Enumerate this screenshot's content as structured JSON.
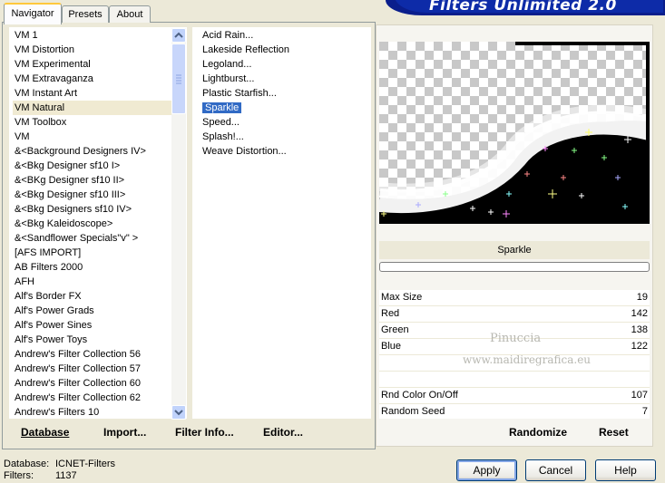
{
  "banner": {
    "title": "Filters Unlimited 2.0"
  },
  "tabs": [
    {
      "label": "Navigator"
    },
    {
      "label": "Presets"
    },
    {
      "label": "About"
    }
  ],
  "categories": [
    "VM 1",
    "VM Distortion",
    "VM Experimental",
    "VM Extravaganza",
    "VM Instant Art",
    "VM Natural",
    "VM Toolbox",
    "VM",
    "&<Background Designers IV>",
    "&<Bkg Designer sf10 I>",
    "&<BKg Designer sf10 II>",
    "&<Bkg Designer sf10 III>",
    "&<Bkg Designers sf10 IV>",
    "&<Bkg Kaleidoscope>",
    "&<Sandflower Specials\"v\" >",
    "[AFS IMPORT]",
    "AB Filters 2000",
    "AFH",
    "Alf's Border FX",
    "Alf's Power Grads",
    "Alf's Power Sines",
    "Alf's Power Toys",
    "Andrew's Filter Collection 56",
    "Andrew's Filter Collection 57",
    "Andrew's Filter Collection 60",
    "Andrew's Filter Collection 62",
    "Andrew's Filters 10"
  ],
  "filters": [
    "Acid Rain...",
    "Lakeside Reflection",
    "Legoland...",
    "Lightburst...",
    "Plastic Starfish...",
    "Sparkle",
    "Speed...",
    "Splash!...",
    "Weave Distortion..."
  ],
  "bottom_buttons": {
    "database": "Database",
    "import": "Import...",
    "filter_info": "Filter Info...",
    "editor": "Editor..."
  },
  "preview": {
    "filter_name": "Sparkle"
  },
  "params": [
    {
      "name": "Max Size",
      "value": "19"
    },
    {
      "name": "Red",
      "value": "142"
    },
    {
      "name": "Green",
      "value": "138"
    },
    {
      "name": "Blue",
      "value": "122"
    },
    {
      "name": "",
      "value": ""
    },
    {
      "name": "",
      "value": ""
    },
    {
      "name": "Rnd Color On/Off",
      "value": "107"
    },
    {
      "name": "Random Seed",
      "value": "7"
    }
  ],
  "watermark": {
    "line1": "Pinuccia",
    "line2": "www.maidiregrafica.eu"
  },
  "right_buttons": {
    "randomize": "Randomize",
    "reset": "Reset"
  },
  "status": {
    "database_label": "Database:",
    "database_value": "ICNET-Filters",
    "filters_label": "Filters:",
    "filters_value": "1137"
  },
  "dialog_buttons": {
    "apply": "Apply",
    "cancel": "Cancel",
    "help": "Help"
  },
  "colors": {
    "selection": "#316ac5",
    "banner": "#0d2ba8",
    "face": "#ece9d8"
  }
}
